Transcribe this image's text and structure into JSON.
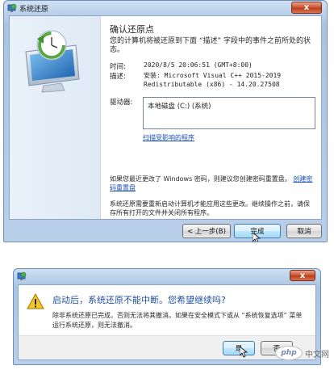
{
  "main_window": {
    "title": "系统还原",
    "close_label": "x",
    "heading": "确认还原点",
    "intro": "您的计算机将被还原到下面 “描述” 字段中的事件之前所处的状态。",
    "time_label": "时间:",
    "time_value": "2020/8/5 20:06:51 (GMT+8:00)",
    "desc_label": "描述:",
    "desc_line1": "安装: Microsoft Visual C++ 2015-2019",
    "desc_line2": "Redistributable (x86) - 14.20.27508",
    "drives_label": "驱动器:",
    "drives_value": "本地磁盘 (C:) (系统)",
    "scan_link": "扫描受影响的程序",
    "password_note": "如果您最近更改了 Windows 密码，则建议您创建密码重置盘。",
    "password_link": "创建密码重置盘",
    "restart_note": "系统还原需要重新启动计算机才能应用这些更改。继续操作之前，请保存所有打开的文件并关闭所有程序。",
    "buttons": {
      "back": "< 上一步(B)",
      "finish": "完成",
      "cancel": "取消"
    }
  },
  "confirm_dialog": {
    "title_icon": "system-restore-icon",
    "close_label": "x",
    "question": "启动后，系统还原不能中断。您希望继续吗?",
    "detail": "除非系统还原已完成，否则无法将其撤消。如果在安全模式下或从 “系统恢复选项” 菜单运行系统还原，则无法撤消。",
    "yes_label": "是",
    "no_label": "否"
  },
  "watermark": {
    "logo_text": "php",
    "site_text": "中文网"
  }
}
